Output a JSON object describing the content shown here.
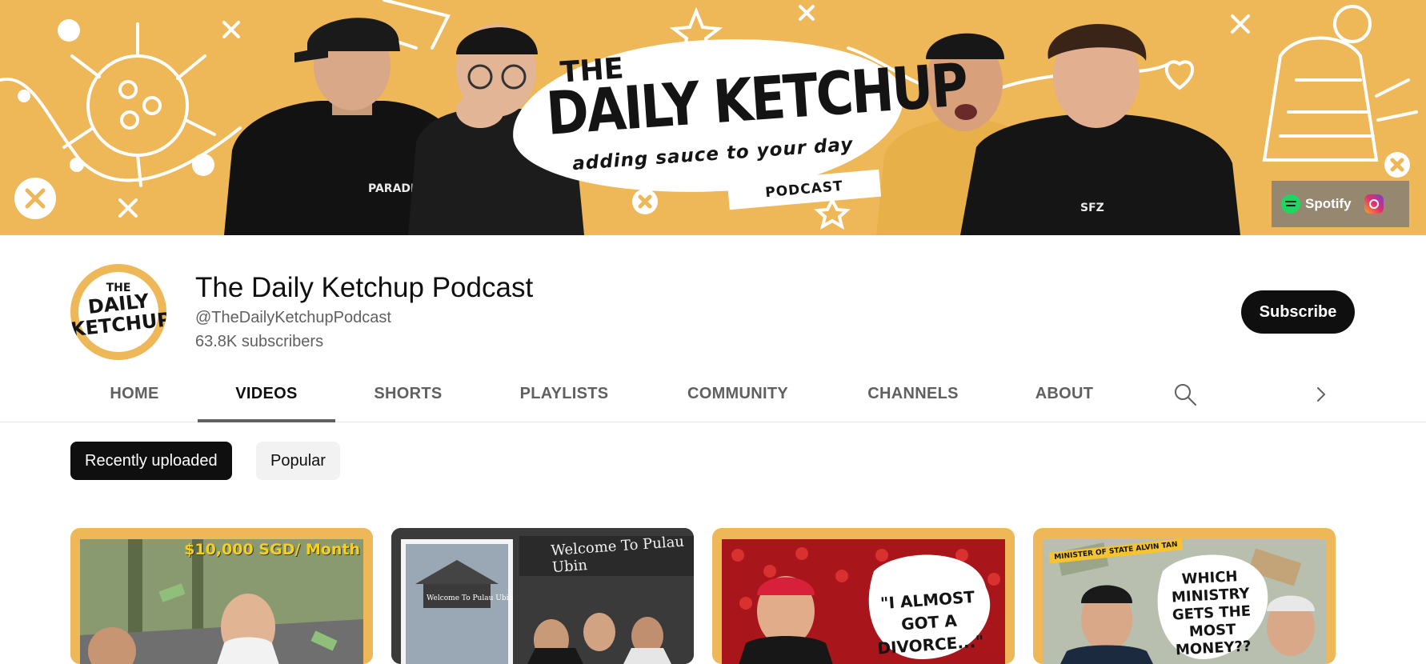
{
  "banner": {
    "title_the": "THE",
    "title_main": "DAILY KETCHUP",
    "tagline": "adding sauce to your day",
    "podcast_label": "PODCAST",
    "shirt_text": "PARADISE",
    "links": [
      {
        "label": "Spotify",
        "icon": "spotify-icon"
      },
      {
        "label": "",
        "icon": "instagram-icon"
      }
    ],
    "color": "#eeb758"
  },
  "channel": {
    "avatar_the": "THE",
    "avatar_line1": "DAILY",
    "avatar_line2": "KETCHUP",
    "name": "The Daily Ketchup Podcast",
    "handle": "@TheDailyKetchupPodcast",
    "subscribers": "63.8K subscribers",
    "subscribe_label": "Subscribe"
  },
  "tabs": [
    {
      "label": "HOME",
      "active": false
    },
    {
      "label": "VIDEOS",
      "active": true
    },
    {
      "label": "SHORTS",
      "active": false
    },
    {
      "label": "PLAYLISTS",
      "active": false
    },
    {
      "label": "COMMUNITY",
      "active": false
    },
    {
      "label": "CHANNELS",
      "active": false
    },
    {
      "label": "ABOUT",
      "active": false
    }
  ],
  "chips": [
    {
      "label": "Recently uploaded",
      "active": true
    },
    {
      "label": "Popular",
      "active": false
    }
  ],
  "thumbnails": [
    {
      "text": "$10,000 SGD/ Month"
    },
    {
      "text": "Welcome To Pulau Ubin",
      "sign": "Welcome To Pulau Ubin"
    },
    {
      "text": "\"I ALMOST GOT A DIVORCE...\""
    },
    {
      "text": "WHICH MINISTRY GETS THE MOST MONEY??",
      "label": "MINISTER OF STATE ALVIN TAN"
    }
  ]
}
